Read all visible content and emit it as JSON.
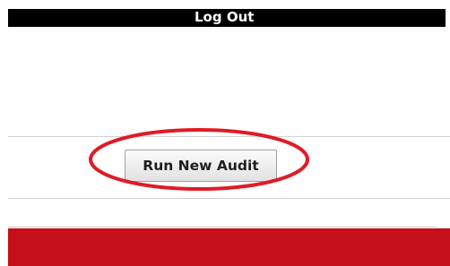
{
  "header": {
    "logout_label": "Log Out"
  },
  "main": {
    "run_audit_label": "Run New Audit"
  },
  "colors": {
    "header_bar": "#000000",
    "footer_bar": "#c40f1a",
    "highlight_ring": "#e01b24"
  }
}
